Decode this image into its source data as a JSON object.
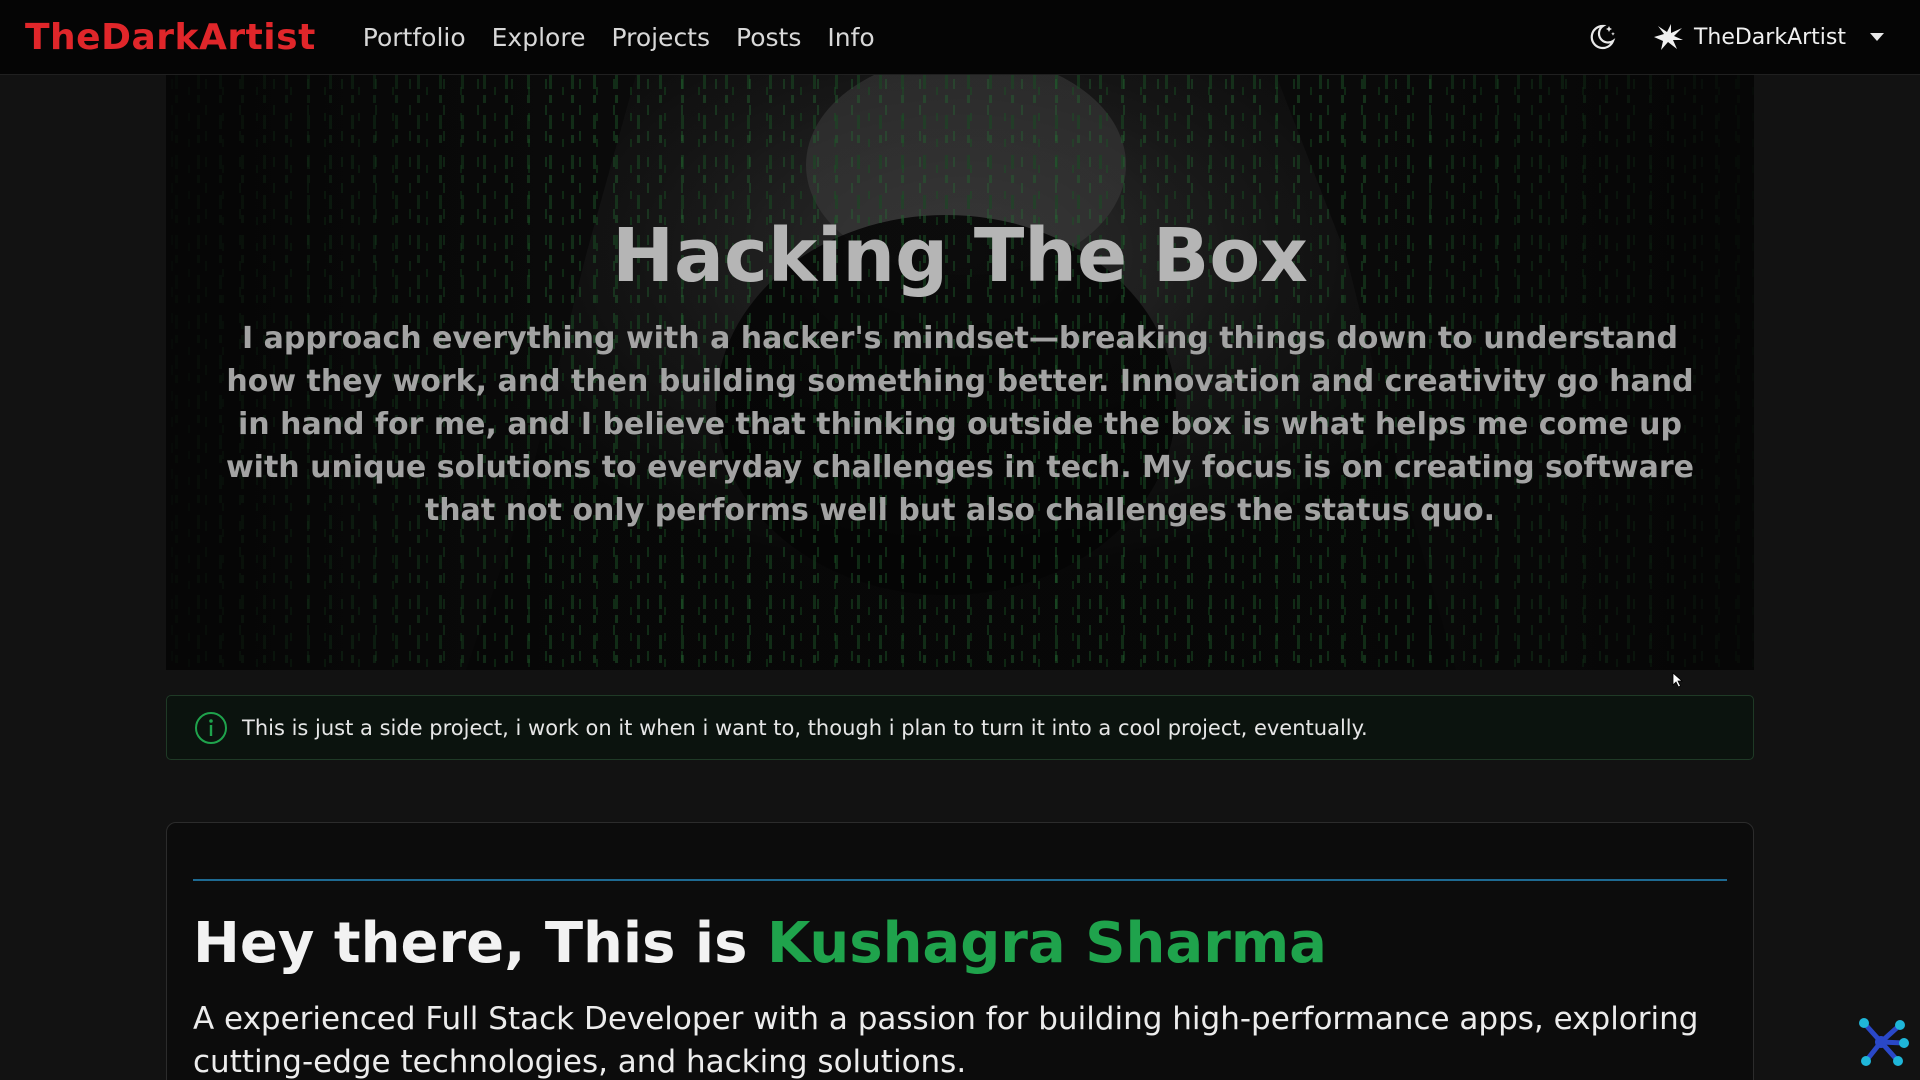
{
  "navbar": {
    "brand": "TheDarkArtist",
    "links": [
      "Portfolio",
      "Explore",
      "Projects",
      "Posts",
      "Info"
    ],
    "theme_icon": "moon-stars-icon",
    "user": {
      "name": "TheDarkArtist",
      "avatar_icon": "splat-logo-icon"
    }
  },
  "hero": {
    "title": "Hacking The Box",
    "text": "I approach everything with a hacker's mindset—breaking things down to understand how they work, and then building something better. Innovation and creativity go hand in hand for me, and I believe that thinking outside the box is what helps me come up with unique solutions to everyday challenges in tech. My focus is on creating software that not only performs well but also challenges the status quo.",
    "background": "hooded-figure-matrix-code-image"
  },
  "alert": {
    "icon": "info-circle-icon",
    "text": "This is just a side project, i work on it when i want to, though i plan to turn it into a cool project, eventually."
  },
  "intro": {
    "greeting": "Hey there, This is ",
    "name": "Kushagra Sharma",
    "description": "A experienced Full Stack Developer with a passion for building high-performance apps, exploring cutting-edge technologies, and hacking solutions."
  },
  "widget": {
    "icon": "network-nodes-icon"
  },
  "colors": {
    "brand_red": "#e0262a",
    "accent_green": "#1fa34c",
    "rule_blue": "#1e6a92",
    "widget_cyan": "#1fb6d9",
    "widget_blue": "#2a48c8"
  }
}
